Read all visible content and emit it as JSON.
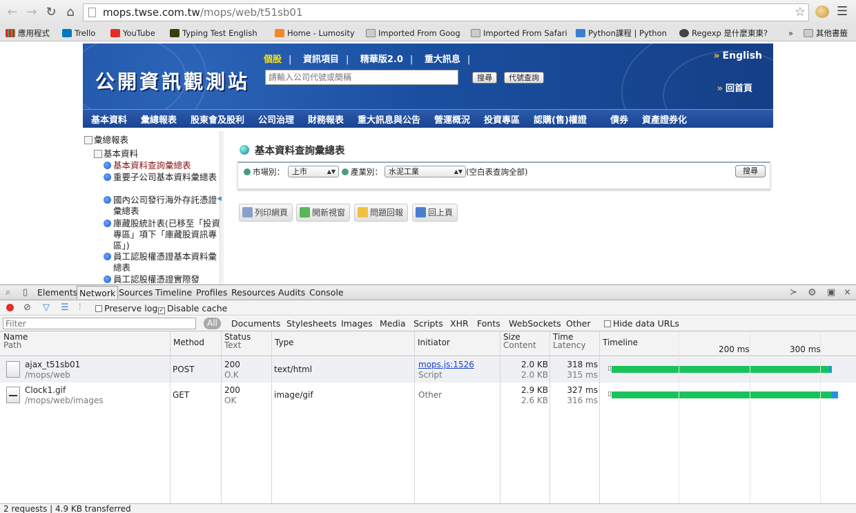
{
  "browser": {
    "url_host": "mops.twse.com.tw",
    "url_path": "/mops/web/t51sb01",
    "bookmarks": [
      {
        "label": "應用程式",
        "icon": "apps-icon"
      },
      {
        "label": "Trello",
        "icon": "trello-icon"
      },
      {
        "label": "YouTube",
        "icon": "youtube-icon"
      },
      {
        "label": "Typing Test English",
        "icon": "typing-icon"
      },
      {
        "label": "Home - Lumosity",
        "icon": "lumosity-icon"
      },
      {
        "label": "Imported From Goog",
        "icon": "folder-icon"
      },
      {
        "label": "Imported From Safari",
        "icon": "folder-icon"
      },
      {
        "label": "Python課程 | Python",
        "icon": "python-icon"
      },
      {
        "label": "Regexp 是什麼東東?",
        "icon": "regexp-icon"
      },
      {
        "label": "»",
        "icon": ""
      },
      {
        "label": "其他書籤",
        "icon": "folder-icon"
      }
    ]
  },
  "site": {
    "logo": "公開資訊觀測站",
    "top_links": [
      "個股",
      "資訊項目",
      "精華版2.0",
      "重大訊息"
    ],
    "search_placeholder": "請輸入公司代號或簡稱",
    "search_button": "搜尋",
    "code_lookup_button": "代號查詢",
    "english": "English",
    "home": "回首頁",
    "menu": [
      "基本資料",
      "彙總報表",
      "股東會及股利",
      "公司治理",
      "財務報表",
      "重大訊息與公告",
      "營運概況",
      "投資專區",
      "認購(售)權證",
      "債券",
      "資產證券化"
    ]
  },
  "tree": {
    "root": "彙總報表",
    "group": "基本資料",
    "items": [
      "基本資料查詢彙總表",
      "重要子公司基本資料彙總表",
      "國內公司發行海外存託憑證彙總表",
      "庫藏股統計表(已移至「投資專區」項下「庫藏股資訊專區」)",
      "員工認股權憑證基本資料彙總表",
      "員工認股權憑證實際發"
    ]
  },
  "content": {
    "title": "基本資料查詢彙總表",
    "market_label": "市場別：",
    "market_value": "上市",
    "industry_label": "產業別：",
    "industry_value": "水泥工業",
    "industry_hint": "(空白表查詢全部)",
    "query_button": "搜尋",
    "actions": [
      "列印網頁",
      "開新視窗",
      "問題回報",
      "回上頁"
    ]
  },
  "devtools": {
    "tabs": [
      "Elements",
      "Network",
      "Sources",
      "Timeline",
      "Profiles",
      "Resources",
      "Audits",
      "Console"
    ],
    "selected_tab": "Network",
    "preserve_log": "Preserve log",
    "disable_cache": "Disable cache",
    "filter_placeholder": "Filter",
    "type_filters": [
      "All",
      "Documents",
      "Stylesheets",
      "Images",
      "Media",
      "Scripts",
      "XHR",
      "Fonts",
      "WebSockets",
      "Other"
    ],
    "hide_data_urls": "Hide data URLs",
    "columns": {
      "name": "Name",
      "path": "Path",
      "method": "Method",
      "status": "Status",
      "text": "Text",
      "type": "Type",
      "initiator": "Initiator",
      "size": "Size",
      "content": "Content",
      "time": "Time",
      "latency": "Latency",
      "timeline": "Timeline"
    },
    "timeline_ticks": [
      "200 ms",
      "300 ms"
    ],
    "requests": [
      {
        "name": "ajax_t51sb01",
        "path": "/mops/web",
        "method": "POST",
        "status": "200",
        "status_text": "O.K",
        "type": "text/html",
        "initiator": "mops.js:1526",
        "initiator_sub": "Script",
        "size": "2.0 KB",
        "content": "2.0 KB",
        "time": "318 ms",
        "latency": "315 ms"
      },
      {
        "name": "Clock1.gif",
        "path": "/mops/web/images",
        "method": "GET",
        "status": "200",
        "status_text": "OK",
        "type": "image/gif",
        "initiator": "Other",
        "initiator_sub": "",
        "size": "2.9 KB",
        "content": "2.6 KB",
        "time": "327 ms",
        "latency": "316 ms"
      }
    ],
    "summary": "2 requests | 4.9 KB transferred"
  }
}
